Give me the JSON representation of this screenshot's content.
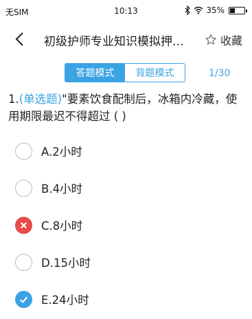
{
  "status_bar": {
    "carrier": "无SIM",
    "time": "10:13",
    "battery": "35%",
    "battery_level": 0.35
  },
  "nav": {
    "title": "初级护师专业知识模拟押…",
    "favorite_label": "收藏",
    "icons": [
      "back-arrow-icon",
      "star-outline-icon"
    ]
  },
  "mode_tabs": [
    {
      "label": "答题模式",
      "active": true
    },
    {
      "label": "背题模式",
      "active": false
    }
  ],
  "progress": "1/30",
  "question": {
    "number": "1.",
    "type": "(单选题)",
    "text": "\"要素饮食配制后，冰箱内冷藏，使用期限最迟不得超过 ( )"
  },
  "options": [
    {
      "label": "A.2小时",
      "state": "none"
    },
    {
      "label": "B.4小时",
      "state": "none"
    },
    {
      "label": "C.8小时",
      "state": "wrong"
    },
    {
      "label": "D.15小时",
      "state": "none"
    },
    {
      "label": "E.24小时",
      "state": "correct"
    }
  ],
  "colors": {
    "accent": "#3aa3e3",
    "wrong": "#e94a4a",
    "radio_border": "#bdbdbd"
  }
}
